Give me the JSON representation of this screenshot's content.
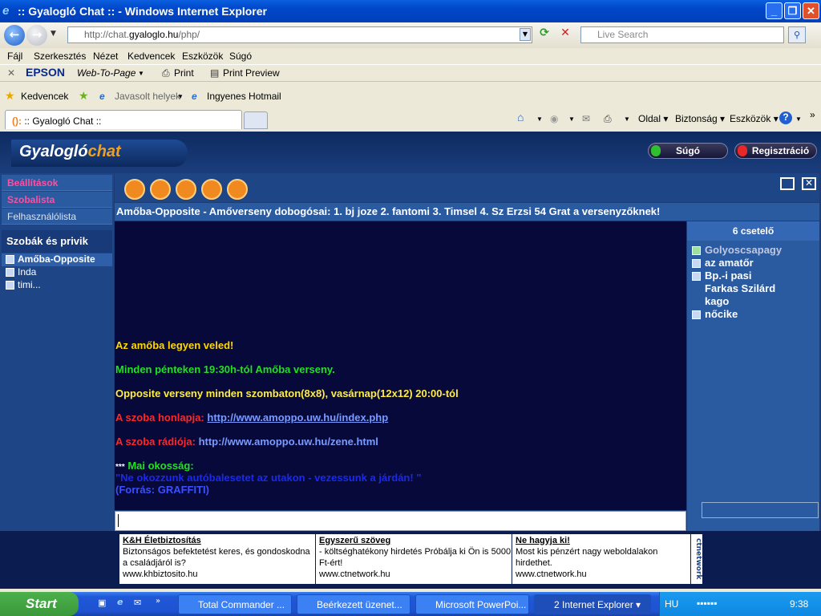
{
  "window": {
    "title": ":: Gyalogló Chat :: - Windows Internet Explorer"
  },
  "address": {
    "prefix": "http://chat.",
    "domain": "gyaloglo.hu",
    "suffix": "/php/"
  },
  "search": {
    "placeholder": "Live Search"
  },
  "menu": [
    "Fájl",
    "Szerkesztés",
    "Nézet",
    "Kedvencek",
    "Eszközök",
    "Súgó"
  ],
  "epson": {
    "brand": "EPSON",
    "web_to_page": "Web-To-Page",
    "print": "Print",
    "print_preview": "Print Preview"
  },
  "favorites": {
    "label": "Kedvencek",
    "suggested": "Javasolt helyek",
    "hotmail": "Ingyenes Hotmail"
  },
  "tab": {
    "title": ":: Gyalogló Chat ::"
  },
  "cmdbar": {
    "page": "Oldal",
    "safety": "Biztonság",
    "tools": "Eszközök"
  },
  "site": {
    "logo_main": "Gyalogló",
    "logo_chat": "chat",
    "help_btn": "Súgó",
    "register_btn": "Regisztráció"
  },
  "sidebar": {
    "items": [
      "Beállítások",
      "Szobalista",
      "Felhasználólista"
    ],
    "rooms_header": "Szobák és privik",
    "rooms": [
      "Amőba-Opposite",
      "Inda",
      "timi..."
    ]
  },
  "topic": "Amőba-Opposite - Amőverseny dobogósai: 1. bj joze 2. fantomi 3. Timsel 4. Sz Erzsi 54 Grat a versenyzőknek!",
  "messages": {
    "m1": "Az amőba legyen veled!",
    "m2": "Minden pénteken 19:30h-tól Amőba verseny.",
    "m3": "Opposite verseny minden szombaton(8x8), vasárnap(12x12) 20:00-tól",
    "m4_label": "A szoba honlapja:",
    "m4_link": "http://www.amoppo.uw.hu/index.php",
    "m5_label": "A szoba rádiója:",
    "m5_link": "http://www.amoppo.uw.hu/zene.html",
    "m6_stars": "***",
    "m6_label": "Mai okosság:",
    "m6_quote": "\"Ne okozzunk autóbalesetet az utakon - vezessunk a járdán! \"",
    "m6_source": "(Forrás: GRAFFITI)"
  },
  "users": {
    "count": "6 csetelő",
    "list": [
      "Golyoscsapagy",
      "az amatőr",
      "Bp.-i pasi",
      "Farkas Szilárd",
      "kago",
      "nőcike"
    ]
  },
  "ads": [
    {
      "title": "K&H Életbiztosítás",
      "body": "Biztonságos befektetést keres, és gondoskodna a családjáról is?",
      "url": "www.khbiztosito.hu"
    },
    {
      "title": "Egyszerű szöveg",
      "body": "- költséghatékony hirdetés Próbálja ki Ön is 5000 Ft-ért!",
      "url": "www.ctnetwork.hu"
    },
    {
      "title": "Ne hagyja ki!",
      "body": "Most kis pénzért nagy weboldalakon hirdethet.",
      "url": "www.ctnetwork.hu"
    }
  ],
  "ctnetwork": "ctnetwork",
  "taskbar": {
    "start": "Start",
    "buttons": [
      "Total Commander ...",
      "Beérkezett üzenet...",
      "Microsoft PowerPoi...",
      "2 Internet Explorer"
    ],
    "lang": "HU",
    "clock": "9:38"
  },
  "colors": {
    "accent_pink": "#ff4fa0",
    "highlight_yellow": "#ffd800",
    "green": "#22e022",
    "red": "#ff2020",
    "link_blue": "#7a9bff"
  }
}
